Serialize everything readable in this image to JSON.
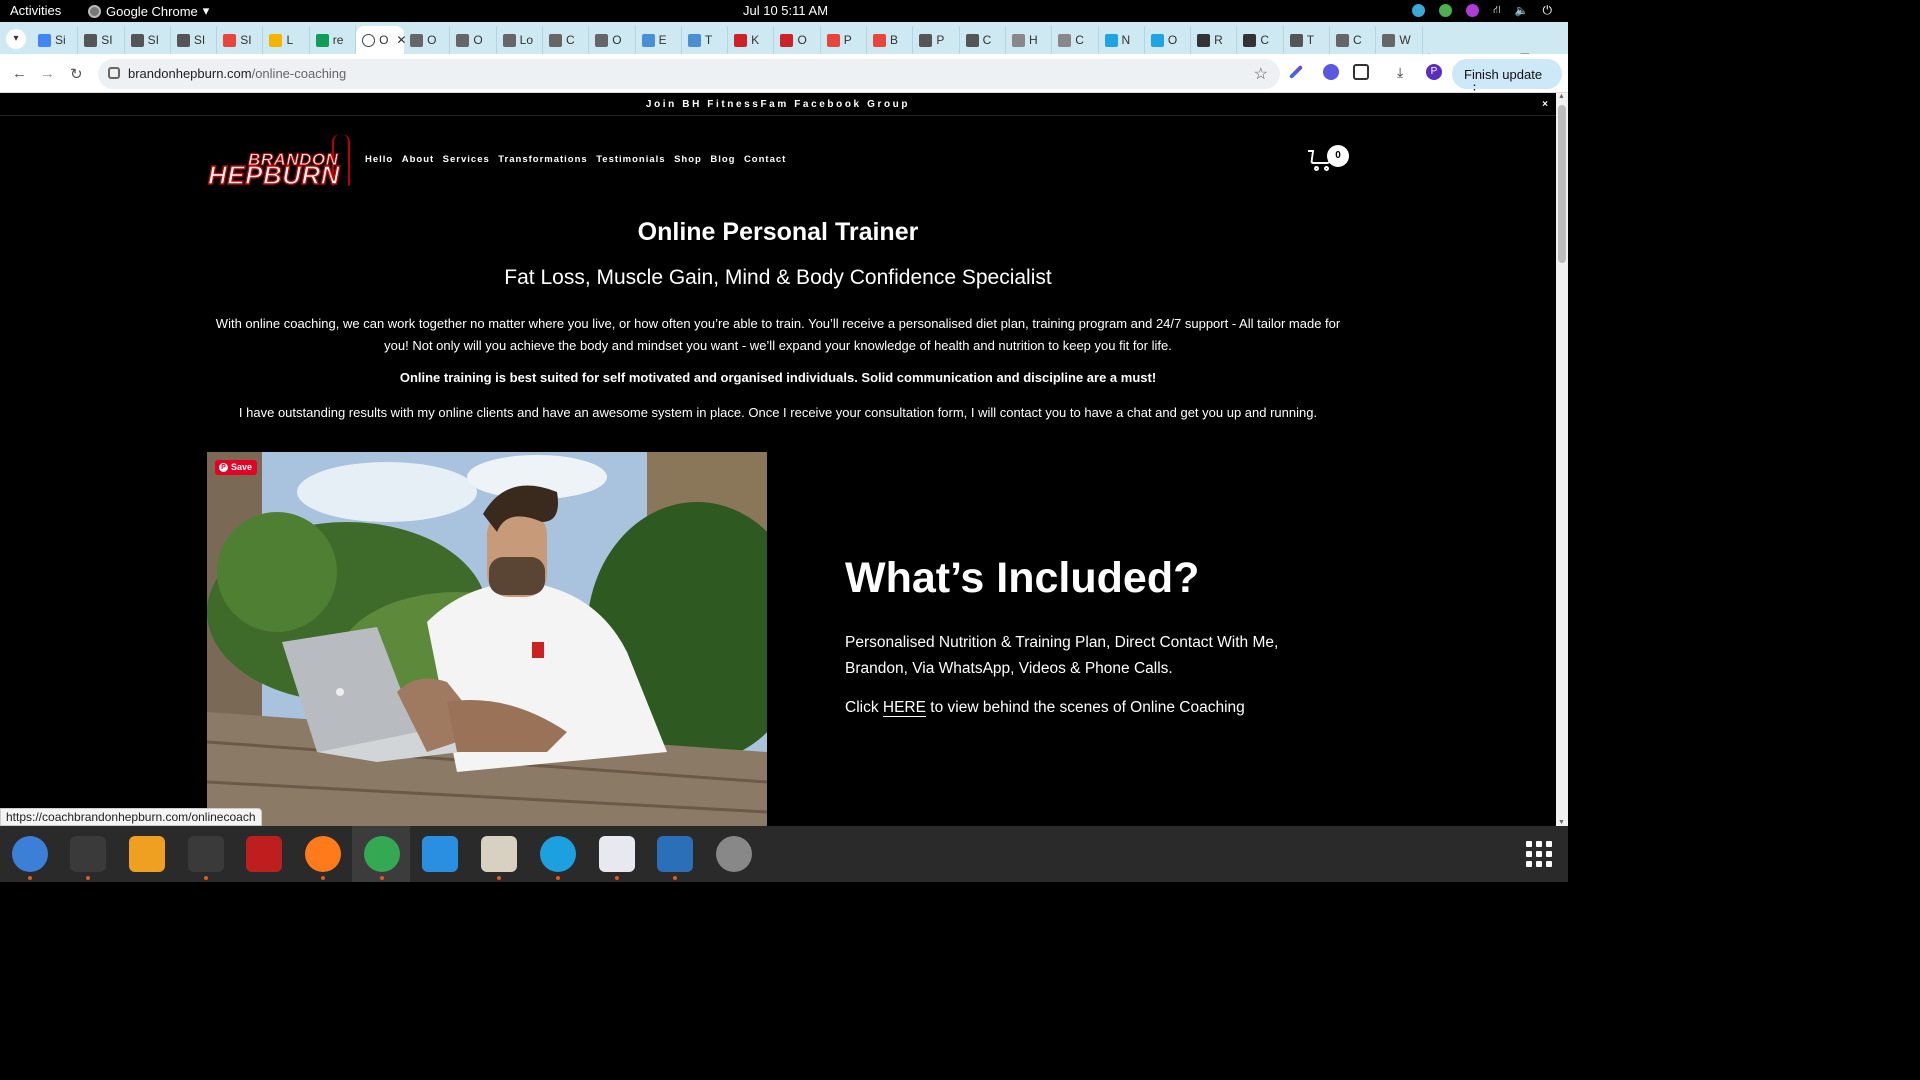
{
  "system": {
    "activities": "Activities",
    "app_name": "Google Chrome",
    "clock": "Jul 10  5:11 AM"
  },
  "browser": {
    "tabs": [
      {
        "label": "Si",
        "color": "#4285f4"
      },
      {
        "label": "SI",
        "color": "#555555"
      },
      {
        "label": "SI",
        "color": "#555555"
      },
      {
        "label": "SI",
        "color": "#555555"
      },
      {
        "label": "SI",
        "color": "#e8453c"
      },
      {
        "label": "L",
        "color": "#f4b400"
      },
      {
        "label": "re",
        "color": "#0f9d58"
      },
      {
        "label": "O",
        "color": "#ffffff",
        "active": true
      },
      {
        "label": "O",
        "color": "#666666"
      },
      {
        "label": "O",
        "color": "#666666"
      },
      {
        "label": "Lo",
        "color": "#666666"
      },
      {
        "label": "C",
        "color": "#666666"
      },
      {
        "label": "O",
        "color": "#666666"
      },
      {
        "label": "E",
        "color": "#4a8fd4"
      },
      {
        "label": "T",
        "color": "#4a8fd4"
      },
      {
        "label": "K",
        "color": "#cc2229"
      },
      {
        "label": "O",
        "color": "#cc2229"
      },
      {
        "label": "P",
        "color": "#e8453c"
      },
      {
        "label": "B",
        "color": "#e8453c"
      },
      {
        "label": "P",
        "color": "#555555"
      },
      {
        "label": "C",
        "color": "#555555"
      },
      {
        "label": "H",
        "color": "#888888"
      },
      {
        "label": "C",
        "color": "#888888"
      },
      {
        "label": "N",
        "color": "#1fa3e3"
      },
      {
        "label": "O",
        "color": "#1fa3e3"
      },
      {
        "label": "R",
        "color": "#333333"
      },
      {
        "label": "C",
        "color": "#333333"
      },
      {
        "label": "T",
        "color": "#555555"
      },
      {
        "label": "C",
        "color": "#666666"
      },
      {
        "label": "W",
        "color": "#666666"
      }
    ],
    "url_host": "brandonhepburn.com",
    "url_path": "/online-coaching",
    "finish_update": "Finish update",
    "profile_initial": "P",
    "status_url": "https://coachbrandonhepburn.com/onlinecoach"
  },
  "site": {
    "banner": "Join BH FitnessFam Facebook Group",
    "banner_close": "×",
    "logo_line1": "BRANDON",
    "logo_line2": "HEPBURN",
    "nav": [
      "Hello",
      "About",
      "Services",
      "Transformations",
      "Testimonials",
      "Shop",
      "Blog",
      "Contact"
    ],
    "cart_count": "0",
    "title": "Online Personal Trainer",
    "subtitle": "Fat Loss, Muscle Gain, Mind & Body Confidence Specialist",
    "para1": "With online coaching, we can work together no matter where you live, or how often you’re able to train.  You’ll receive a personalised diet plan, training program and 24/7 support - All tailor made for you!  Not only will you achieve the body and mindset you want - we’ll expand your knowledge of health and nutrition to keep you fit for life.",
    "para2": "Online training is best suited for self motivated and organised individuals. Solid communication and discipline are a must!",
    "para3": "I have outstanding results with my online clients and have an awesome system in place. Once I receive your consultation form, I will contact you to have a chat and get you up and running.",
    "save_label": "Save",
    "included_title": "What’s Included?",
    "included_text": "Personalised Nutrition & Training Plan, Direct Contact With Me, Brandon, Via WhatsApp, Videos & Phone Calls.",
    "click_prefix": "Click ",
    "click_link": "HERE",
    "click_suffix": " to view behind the scenes of Online Coaching"
  },
  "dock": [
    {
      "name": "thunderbird-icon",
      "color": "#3b7fd6"
    },
    {
      "name": "terminal-icon",
      "color": "#3a3a3a"
    },
    {
      "name": "calculator-icon",
      "color": "#f0a020"
    },
    {
      "name": "system-monitor-icon",
      "color": "#3a3a3a"
    },
    {
      "name": "filezilla-icon",
      "color": "#bf1e1e"
    },
    {
      "name": "firefox-icon",
      "color": "#ff7a1a"
    },
    {
      "name": "chrome-icon",
      "color": "#34a853"
    },
    {
      "name": "vscode-icon",
      "color": "#2a8fe0"
    },
    {
      "name": "files-icon",
      "color": "#d8d0c0"
    },
    {
      "name": "skype-icon",
      "color": "#1da0e0"
    },
    {
      "name": "text-editor-icon",
      "color": "#e8e8f0"
    },
    {
      "name": "document-viewer-icon",
      "color": "#2a6fb8"
    },
    {
      "name": "disk-utility-icon",
      "color": "#888888"
    }
  ]
}
